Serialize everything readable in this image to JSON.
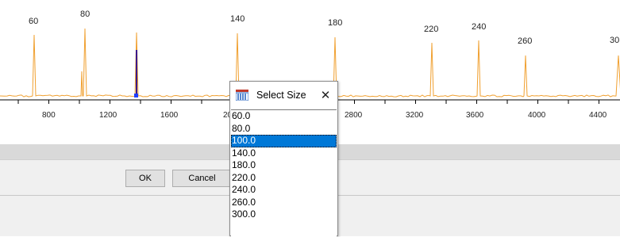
{
  "plot": {
    "line_color": "#f0a030",
    "marker_color": "#3a1a8a",
    "peak_labels": [
      "60",
      "80",
      "140",
      "180",
      "220",
      "240",
      "260",
      "30"
    ],
    "axis_ticks": [
      "800",
      "1200",
      "1600",
      "20",
      "2800",
      "3200",
      "3600",
      "4000",
      "4400"
    ]
  },
  "dialog": {
    "ok_label": "OK",
    "cancel_label": "Cancel"
  },
  "popup": {
    "title": "Select Size",
    "close_icon": "close-icon",
    "title_icon": "ladder-icon",
    "items": [
      "60.0",
      "80.0",
      "100.0",
      "140.0",
      "180.0",
      "220.0",
      "240.0",
      "260.0",
      "300.0"
    ],
    "selected": "100.0",
    "selected_color": "#0078d7"
  }
}
